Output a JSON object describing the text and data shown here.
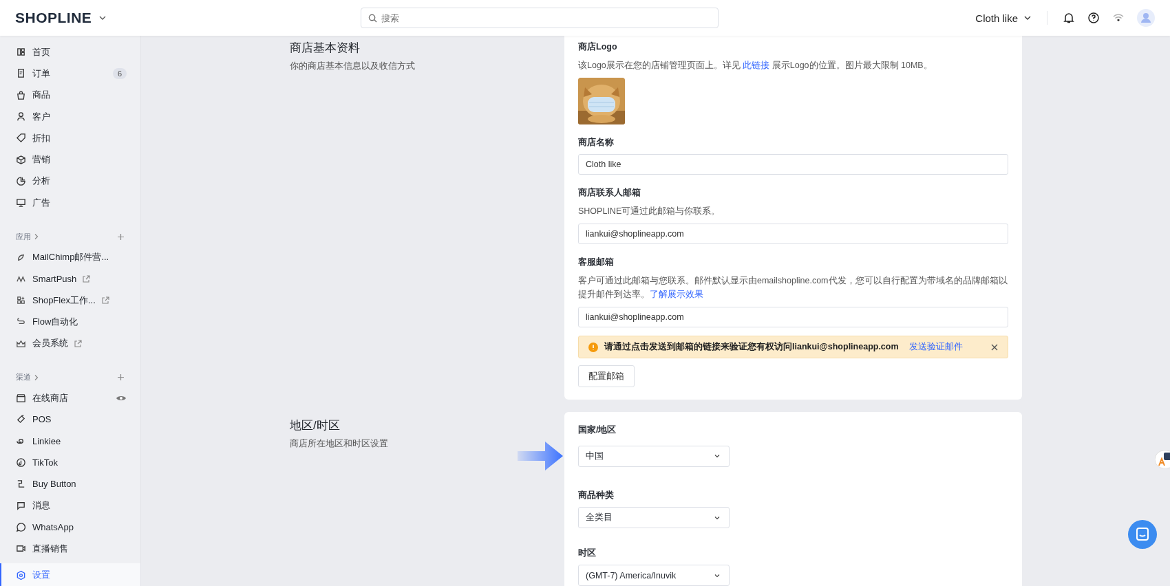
{
  "header": {
    "logo": "SHOPLINE",
    "search": {
      "placeholder": "搜索"
    },
    "store": "Cloth like"
  },
  "sidebar": {
    "main": [
      {
        "label": "首页",
        "selected": false
      },
      {
        "label": "订单",
        "badge": "6",
        "selected": false
      },
      {
        "label": "商品",
        "selected": false
      },
      {
        "label": "客户",
        "selected": false
      },
      {
        "label": "折扣",
        "selected": false
      },
      {
        "label": "营销",
        "selected": false
      },
      {
        "label": "分析",
        "selected": false
      },
      {
        "label": "广告",
        "selected": false
      }
    ],
    "apps": {
      "title": "应用",
      "items": [
        {
          "label": "MailChimp邮件营...",
          "external": false,
          "selected": false
        },
        {
          "label": "SmartPush",
          "external": true,
          "selected": false
        },
        {
          "label": "ShopFlex工作...",
          "external": true,
          "selected": false
        },
        {
          "label": "Flow自动化",
          "external": false,
          "selected": false
        },
        {
          "label": "会员系统",
          "external": true,
          "selected": false
        }
      ]
    },
    "channels": {
      "title": "渠道",
      "items": [
        {
          "label": "在线商店",
          "viewable": true,
          "selected": false
        },
        {
          "label": "POS",
          "viewable": false,
          "selected": false
        },
        {
          "label": "Linkiee",
          "viewable": false,
          "selected": false
        },
        {
          "label": "TikTok",
          "viewable": false,
          "selected": false
        },
        {
          "label": "Buy Button",
          "viewable": false,
          "selected": false
        },
        {
          "label": "消息",
          "viewable": false,
          "selected": false
        },
        {
          "label": "WhatsApp",
          "viewable": false,
          "selected": false
        },
        {
          "label": "直播销售",
          "viewable": false,
          "selected": false
        }
      ]
    },
    "settings": {
      "label": "设置",
      "selected": true
    }
  },
  "sections": [
    {
      "title": "商店基本资料",
      "subtitle": "你的商店基本信息以及收信方式",
      "fields": [
        {
          "kind": "logo",
          "label": "商店Logo",
          "help": "该Logo展示在您的店铺管理页面上。详见",
          "link": "此链接",
          "help_after": "展示Logo的位置。图片最大限制 10MB。"
        },
        {
          "kind": "input",
          "label": "商店名称",
          "value": "Cloth like"
        },
        {
          "kind": "input",
          "label": "商店联系人邮箱",
          "help": "SHOPLINE可通过此邮箱与你联系。",
          "value": "liankui@shoplineapp.com"
        },
        {
          "kind": "input",
          "label": "客服邮箱",
          "help": "客户可通过此邮箱与您联系。邮件默认显示由emailshopline.com代发，您可以自行配置为带域名的品牌邮箱以提升邮件到达率。",
          "link": "了解展示效果",
          "value": "liankui@shoplineapp.com"
        },
        {
          "kind": "alert",
          "text": "请通过点击发送到邮箱的链接来验证您有权访问liankui@shoplineapp.com",
          "link": "发送验证邮件"
        },
        {
          "kind": "button",
          "label": "配置邮箱"
        }
      ]
    },
    {
      "title": "地区/时区",
      "subtitle": "商店所在地区和时区设置",
      "fields": [
        {
          "kind": "select",
          "label": "国家/地区",
          "value": "中国",
          "pointer": true
        },
        {
          "kind": "select",
          "label": "商品种类",
          "value": "全类目",
          "pointer": false
        },
        {
          "kind": "select",
          "label": "时区",
          "value": "(GMT-7) America/Inuvik",
          "pointer": false
        }
      ]
    }
  ]
}
